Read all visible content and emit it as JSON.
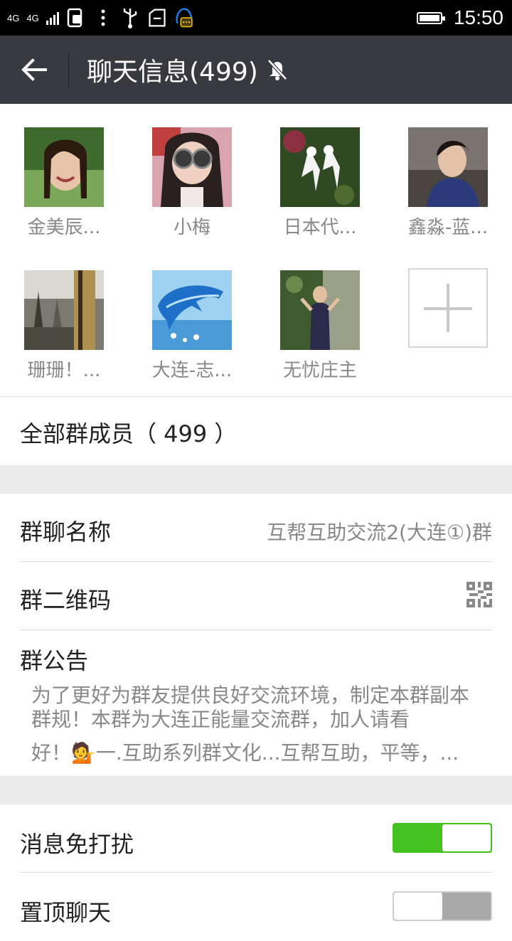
{
  "status_bar": {
    "network_1": "4G",
    "network_2": "4G",
    "time": "15:50",
    "icons": [
      "signal-icon",
      "sim-2-icon",
      "usb-icon",
      "clipboard-icon",
      "qq-icon",
      "battery-icon"
    ]
  },
  "header": {
    "title": "聊天信息(499)",
    "back_icon": "back-arrow-icon",
    "mute_icon": "bell-off-icon"
  },
  "members": [
    {
      "name": "金美辰...",
      "avatar_color": "#5a7a3a"
    },
    {
      "name": "小梅",
      "avatar_color": "#8a5a6a"
    },
    {
      "name": "日本代...",
      "avatar_color": "#2f5a2a"
    },
    {
      "name": "鑫淼-蓝...",
      "avatar_color": "#5a6a7a"
    },
    {
      "name": "珊珊！...",
      "avatar_color": "#6a6a5a"
    },
    {
      "name": "大连-志...",
      "avatar_color": "#2a7ac8"
    },
    {
      "name": "无忧庄主",
      "avatar_color": "#4a6a4a"
    }
  ],
  "all_members_label": "全部群成员（ 499 ）",
  "group_name": {
    "label": "群聊名称",
    "value": "互帮互助交流2(大连①)群"
  },
  "qr_code": {
    "label": "群二维码"
  },
  "announcement": {
    "label": "群公告",
    "line1": "为了更好为群友提供良好交流环境，制定本群副本",
    "line2": "群规！本群为大连正能量交流群，加人请看",
    "line3": "好！💁一.互助系列群文化...互帮互助，平等，..."
  },
  "do_not_disturb": {
    "label": "消息免打扰",
    "on": true
  },
  "pin_chat": {
    "label": "置顶聊天",
    "on": false
  },
  "colors": {
    "titlebar": "#393a3f",
    "toggle_on": "#44c21f",
    "divider": "#ebebeb"
  }
}
